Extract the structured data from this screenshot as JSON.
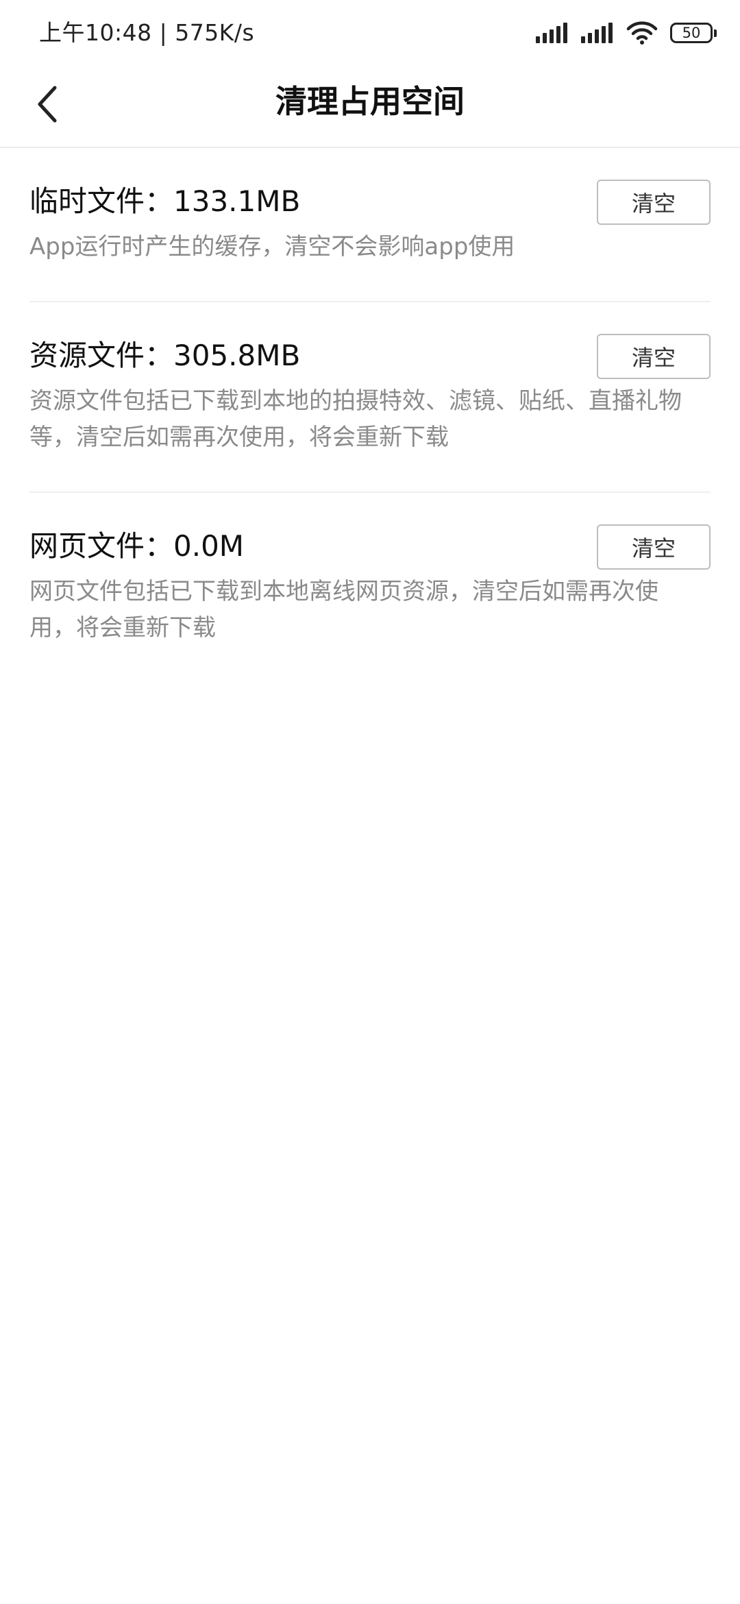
{
  "status_bar": {
    "time_speed": "上午10:48 | 575K/s",
    "battery": "50",
    "icons": [
      "signal-icon",
      "signal-icon",
      "wifi-icon",
      "battery-icon"
    ]
  },
  "nav": {
    "title": "清理占用空间",
    "back_icon": "chevron-left-icon"
  },
  "sections": [
    {
      "title": "临时文件：133.1MB",
      "desc": "App运行时产生的缓存，清空不会影响app使用",
      "button_label": "清空"
    },
    {
      "title": "资源文件：305.8MB",
      "desc": "资源文件包括已下载到本地的拍摄特效、滤镜、贴纸、直播礼物等，清空后如需再次使用，将会重新下载",
      "button_label": "清空"
    },
    {
      "title": "网页文件：0.0M",
      "desc": "网页文件包括已下载到本地离线网页资源，清空后如需再次使用，将会重新下载",
      "button_label": "清空"
    }
  ]
}
